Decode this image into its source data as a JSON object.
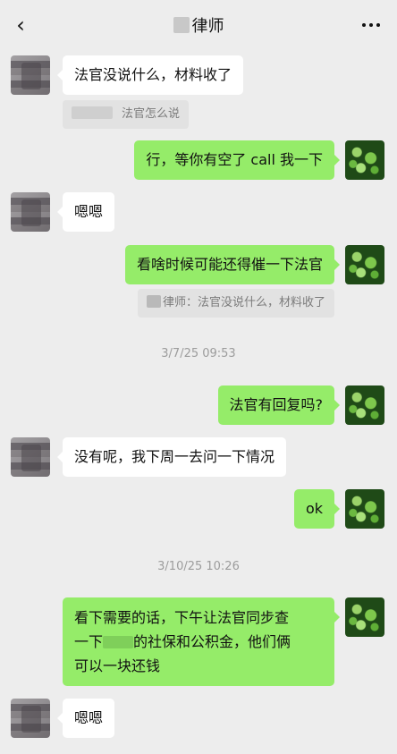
{
  "header": {
    "title": "律师",
    "back_icon": "chevron-left-icon",
    "more_icon": "more-dots-icon"
  },
  "messages": [
    {
      "text": "法官没说什么，材料收了"
    },
    {
      "quote": "法官怎么说"
    },
    {
      "text": "行，等你有空了 call 我一下"
    },
    {
      "text": "嗯嗯"
    },
    {
      "text": "看啥时候可能还得催一下法官"
    },
    {
      "quote": "律师：法官没说什么，材料收了"
    },
    {
      "timestamp": "3/7/25 09:53"
    },
    {
      "text": "法官有回复吗?"
    },
    {
      "text": "没有呢，我下周一去问一下情况"
    },
    {
      "text": "ok"
    },
    {
      "timestamp": "3/10/25 10:26"
    },
    {
      "line1": "看下需要的话，下午让法官同步查",
      "line2_pre": "一下",
      "line2_post": "的社保和公积金，他们俩",
      "line3": "可以一块还钱"
    },
    {
      "text": "嗯嗯"
    }
  ],
  "colors": {
    "background": "#ededed",
    "outgoing_bubble": "#95ec69",
    "incoming_bubble": "#ffffff",
    "quote_bg": "#e2e2e2",
    "timestamp": "#9c9c9c"
  }
}
